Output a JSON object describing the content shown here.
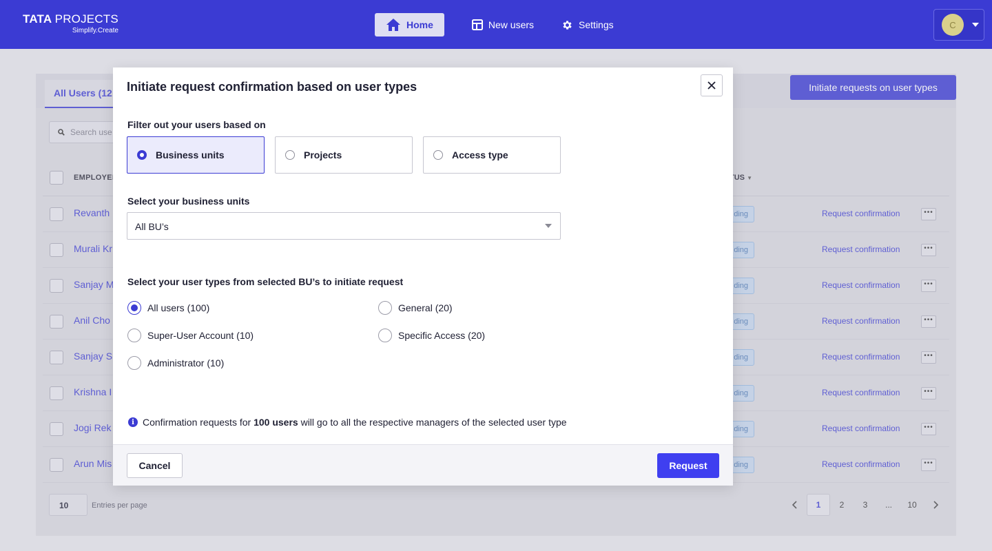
{
  "brand": {
    "name_bold": "TATA",
    "name_light": "PROJECTS",
    "tagline": "Simplify.Create"
  },
  "nav": {
    "items": [
      {
        "label": "Home",
        "icon": "home-icon",
        "active": true
      },
      {
        "label": "New users",
        "icon": "table-icon",
        "active": false
      },
      {
        "label": "Settings",
        "icon": "gear-icon",
        "active": false
      }
    ],
    "avatar_initial": "C"
  },
  "page": {
    "tab_all_users": "All Users (12",
    "initiate_button": "Initiate requests on user types",
    "search_placeholder": "Search use",
    "columns": {
      "employee": "EMPLOYEE",
      "status": "TUS"
    },
    "rows": [
      {
        "name": "Revanth",
        "status": "ding",
        "action": "Request confirmation"
      },
      {
        "name": "Murali Kr",
        "status": "ding",
        "action": "Request confirmation"
      },
      {
        "name": "Sanjay M",
        "status": "ding",
        "action": "Request confirmation"
      },
      {
        "name": "Anil Cho",
        "status": "ding",
        "action": "Request confirmation"
      },
      {
        "name": "Sanjay S",
        "status": "ding",
        "action": "Request confirmation"
      },
      {
        "name": "Krishna I",
        "status": "ding",
        "action": "Request confirmation"
      },
      {
        "name": "Jogi Rek",
        "status": "ding",
        "action": "Request confirmation"
      },
      {
        "name": "Arun Mis",
        "status": "ding",
        "action": "Request confirmation"
      }
    ],
    "entries_value": "10",
    "entries_label": "Entries per page",
    "pagination": [
      "1",
      "2",
      "3",
      "...",
      "10"
    ],
    "current_page": "1"
  },
  "modal": {
    "title": "Initiate request confirmation based on user types",
    "filter_label": "Filter out your users based on",
    "filter_options": [
      {
        "label": "Business units",
        "selected": true
      },
      {
        "label": "Projects",
        "selected": false
      },
      {
        "label": "Access type",
        "selected": false
      }
    ],
    "bu_label": "Select your business units",
    "bu_value": "All BU’s",
    "user_types_label": "Select your user types from selected BU’s  to initiate request",
    "user_types": [
      {
        "label": "All users (100)",
        "selected": true
      },
      {
        "label": "General (20)",
        "selected": false
      },
      {
        "label": "Super-User Account (10)",
        "selected": false
      },
      {
        "label": "Specific Access (20)",
        "selected": false
      },
      {
        "label": "Administrator (10)",
        "selected": false
      }
    ],
    "info_prefix": "Confirmation requests for",
    "info_bold": "100 users",
    "info_suffix": "will go to all the respective managers of the selected user type",
    "cancel_label": "Cancel",
    "request_label": "Request"
  }
}
